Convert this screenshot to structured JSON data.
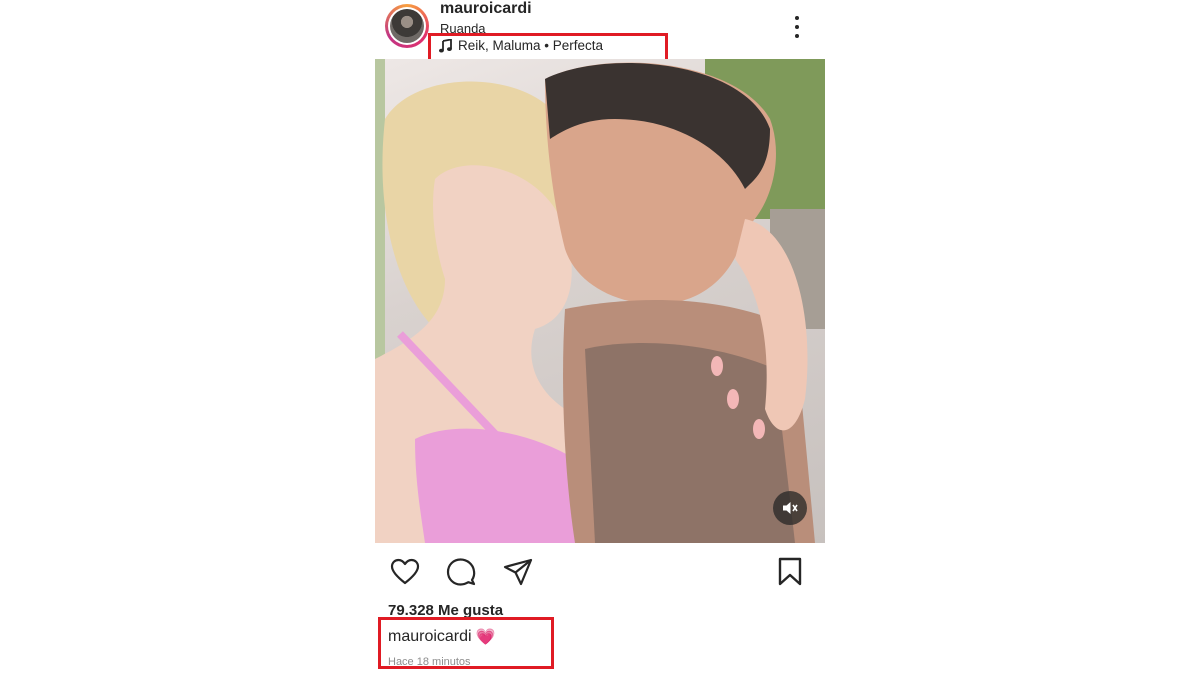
{
  "post": {
    "username": "mauroicardi",
    "location": "Ruanda",
    "music": "Reik, Maluma • Perfecta",
    "likes": "79.328 Me gusta",
    "caption_username": "mauroicardi",
    "caption_emoji": "💗",
    "timestamp": "Hace 18 minutos"
  },
  "icons": {
    "music": "music-note-icon",
    "more": "more-options-icon",
    "mute": "muted-audio-icon",
    "like": "heart-icon",
    "comment": "comment-icon",
    "share": "send-icon",
    "save": "bookmark-icon"
  },
  "colors": {
    "highlight": "#e01b24",
    "text": "#262626",
    "muted_text": "#8e8e8e"
  }
}
